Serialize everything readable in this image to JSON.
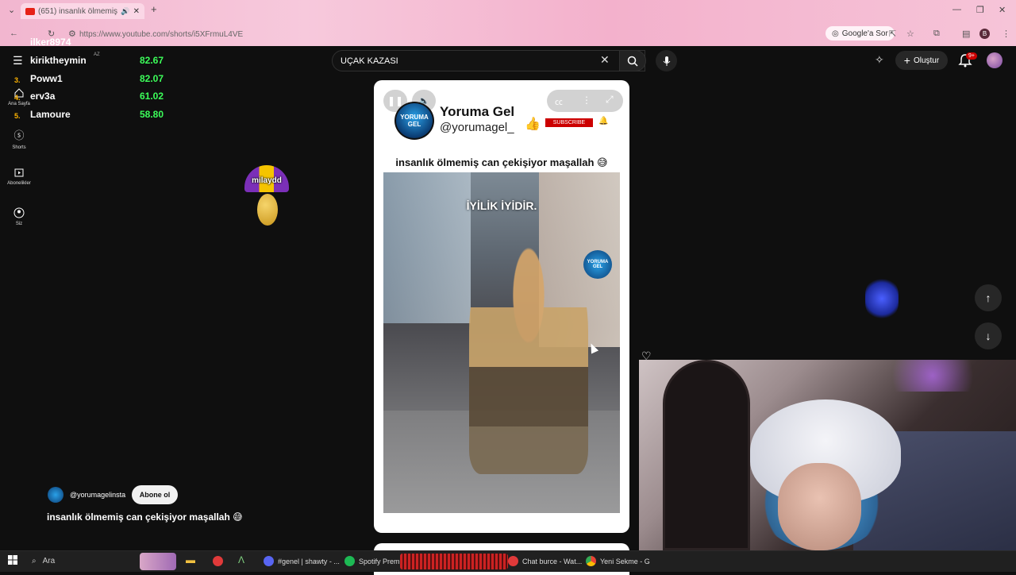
{
  "browser": {
    "tab_title": "(651) insanlık ölmemiş can",
    "url": "https://www.youtube.com/shorts/i5XFrmuL4VE",
    "google_ask": "Google'a Sor",
    "profile_initial": "B"
  },
  "youtube": {
    "search_value": "UÇAK KAZASI",
    "create_label": "Oluştur",
    "notif_count": "9+",
    "country": "AZ"
  },
  "sidebar": {
    "items": [
      {
        "label": "Ana Sayfa",
        "icon": "home-icon"
      },
      {
        "label": "Shorts",
        "icon": "shorts-icon"
      },
      {
        "label": "Abonelikler",
        "icon": "subscriptions-icon"
      },
      {
        "label": "Siz",
        "icon": "user-icon"
      }
    ]
  },
  "leaderboard": {
    "rows": [
      {
        "rank": "",
        "name": "ilker8974",
        "score": ""
      },
      {
        "rank": "",
        "name": "kiriktheymin",
        "score": "82.67"
      },
      {
        "rank": "3.",
        "name": "Poww1",
        "score": "82.07"
      },
      {
        "rank": "4.",
        "name": "erv3a",
        "score": "61.02"
      },
      {
        "rank": "5.",
        "name": "Lamoure",
        "score": "58.80"
      }
    ]
  },
  "short": {
    "channel_name": "Yoruma Gel",
    "channel_handle": "@yorumagel_",
    "logo_text": "YORUMA GEL",
    "subscribe_label": "SUBSCRIBE",
    "title": "insanlık ölmemiş can çekişiyor maşallah 😅",
    "overlay_text": "İYİLİK İYİDİR."
  },
  "channel_bar": {
    "handle": "@yorumagelinsta",
    "subscribe_label": "Abone ol",
    "title": "insanlık ölmemiş can çekişiyor maşallah 😅"
  },
  "sticker": {
    "label": "milaydd"
  },
  "taskbar": {
    "search_label": "Ara",
    "items": [
      {
        "label": "#genel | shawty - ...",
        "color": "#5865f2"
      },
      {
        "label": "Spotify Premiu",
        "color": "#1db954"
      },
      {
        "label": "Chat burce - Wat...",
        "color": "#e03a3a"
      },
      {
        "label": "Yeni Sekme - G",
        "color": "#4285f4"
      }
    ]
  },
  "colors": {
    "accent_red": "#cc0000",
    "score_green": "#3cff5a",
    "rank_gold": "#ffb400"
  }
}
